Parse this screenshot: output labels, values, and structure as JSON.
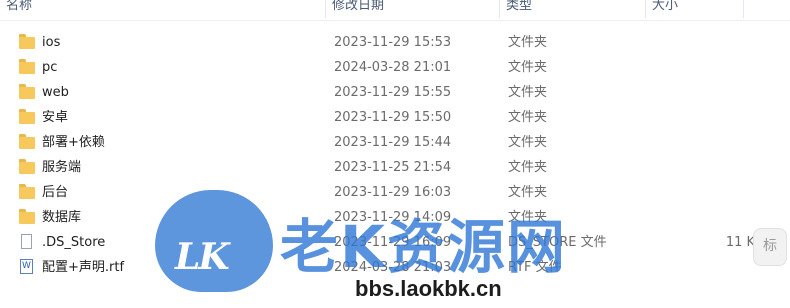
{
  "columns": {
    "name": "名称",
    "date": "修改日期",
    "type": "类型",
    "size": "大小"
  },
  "files": [
    {
      "name": "ios",
      "date": "2023-11-29 15:53",
      "type": "文件夹",
      "size": "",
      "icon": "folder-icon"
    },
    {
      "name": "pc",
      "date": "2024-03-28 21:01",
      "type": "文件夹",
      "size": "",
      "icon": "folder-icon"
    },
    {
      "name": "web",
      "date": "2023-11-29 15:55",
      "type": "文件夹",
      "size": "",
      "icon": "folder-icon"
    },
    {
      "name": "安卓",
      "date": "2023-11-29 15:50",
      "type": "文件夹",
      "size": "",
      "icon": "folder-icon"
    },
    {
      "name": "部署+依赖",
      "date": "2023-11-29 15:44",
      "type": "文件夹",
      "size": "",
      "icon": "folder-icon"
    },
    {
      "name": "服务端",
      "date": "2023-11-25 21:54",
      "type": "文件夹",
      "size": "",
      "icon": "folder-icon"
    },
    {
      "name": "后台",
      "date": "2023-11-29 16:03",
      "type": "文件夹",
      "size": "",
      "icon": "folder-icon"
    },
    {
      "name": "数据库",
      "date": "2023-11-29 14:09",
      "type": "文件夹",
      "size": "",
      "icon": "folder-icon"
    },
    {
      "name": ".DS_Store",
      "date": "2023-11-29 16:09",
      "type": "DS_STORE 文件",
      "size": "11 KB",
      "icon": "file-icon"
    },
    {
      "name": "配置+声明.rtf",
      "date": "2024-03-28 21:03",
      "type": "RTF 文件",
      "size": "",
      "icon": "rtf-document-icon"
    }
  ],
  "watermark": {
    "logo": "LK",
    "title": "老K资源网",
    "url": "bbs.laokbk.cn"
  },
  "edge_button": {
    "label": "标"
  }
}
